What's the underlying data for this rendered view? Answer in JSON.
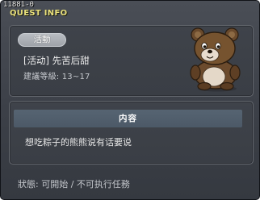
{
  "window": {
    "quest_id": "11881-0",
    "title": "QUEST INFO"
  },
  "quest": {
    "badge_label": "活動",
    "name": "[活动] 先苦后甜",
    "level_text": "建議等級: 13~17",
    "npc_icon": "brown-bear-npc"
  },
  "content": {
    "header": "内容",
    "text": "想吃粽子的熊熊说有话要说"
  },
  "status": {
    "text": "狀態: 可開始 / 不可执行任務"
  },
  "colors": {
    "title": "#e9e07a",
    "window_bg": "#3c4048",
    "panel_border": "#62666d",
    "badge_bg": "#a9adb3",
    "content_header_bg": "#526070"
  }
}
